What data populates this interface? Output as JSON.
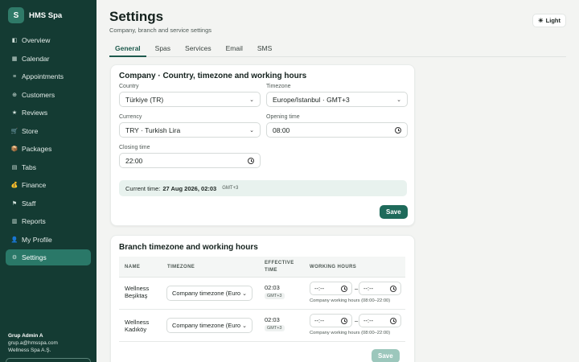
{
  "brand": {
    "logo_letter": "S",
    "name": "HMS Spa"
  },
  "sidebar": {
    "items": [
      {
        "label": "Overview",
        "icon": "overview-icon",
        "glyph": "◧"
      },
      {
        "label": "Calendar",
        "icon": "calendar-icon",
        "glyph": "▦"
      },
      {
        "label": "Appointments",
        "icon": "list-icon",
        "glyph": "≡"
      },
      {
        "label": "Customers",
        "icon": "customers-icon",
        "glyph": "⊕"
      },
      {
        "label": "Reviews",
        "icon": "star-icon",
        "glyph": "★"
      },
      {
        "label": "Store",
        "icon": "cart-icon",
        "glyph": "🛒"
      },
      {
        "label": "Packages",
        "icon": "package-icon",
        "glyph": "📦"
      },
      {
        "label": "Tabs",
        "icon": "receipt-icon",
        "glyph": "▤"
      },
      {
        "label": "Finance",
        "icon": "money-icon",
        "glyph": "💰"
      },
      {
        "label": "Staff",
        "icon": "staff-icon",
        "glyph": "⚑"
      },
      {
        "label": "Reports",
        "icon": "chart-icon",
        "glyph": "▥"
      },
      {
        "label": "My Profile",
        "icon": "profile-icon",
        "glyph": "👤"
      },
      {
        "label": "Settings",
        "icon": "gear-icon",
        "glyph": "⚙"
      }
    ],
    "active_index": 12
  },
  "user": {
    "name": "Grup Admin A",
    "email": "grup.a@hmsspa.com",
    "org": "Wellness Spa A.Ş."
  },
  "header": {
    "title": "Settings",
    "subtitle": "Company, branch and service settings",
    "theme_label": "Light",
    "theme_glyph": "☀"
  },
  "tabs": [
    "General",
    "Spas",
    "Services",
    "Email",
    "SMS"
  ],
  "company": {
    "title": "Company · Country, timezone and working hours",
    "country_label": "Country",
    "country_value": "Türkiye (TR)",
    "timezone_label": "Timezone",
    "timezone_value": "Europe/Istanbul · GMT+3",
    "currency_label": "Currency",
    "currency_value": "TRY · Turkish Lira",
    "opening_label": "Opening time",
    "opening_value": "08:00",
    "closing_label": "Closing time",
    "closing_value": "22:00",
    "current_prefix": "Current time:",
    "current_value": "27 Aug 2026, 02:03",
    "current_tz": "GMT+3",
    "save_label": "Save"
  },
  "branch": {
    "title": "Branch timezone and working hours",
    "columns": {
      "name": "NAME",
      "timezone": "TIMEZONE",
      "effective_1": "EFFECTIVE",
      "effective_2": "TIME",
      "hours": "WORKING HOURS"
    },
    "rows": [
      {
        "name_1": "Wellness",
        "name_2": "Beşiktaş",
        "timezone": "Company timezone (Euro",
        "time": "02:03",
        "tz": "GMT+3",
        "start": "--:--",
        "end": "--:--",
        "hint": "Company working hours (08:00–22:00)"
      },
      {
        "name_1": "Wellness",
        "name_2": "Kadıköy",
        "timezone": "Company timezone (Euro",
        "time": "02:03",
        "tz": "GMT+3",
        "start": "--:--",
        "end": "--:--",
        "hint": "Company working hours (08:00–22:00)"
      }
    ],
    "separator": "–",
    "save_label": "Save"
  }
}
